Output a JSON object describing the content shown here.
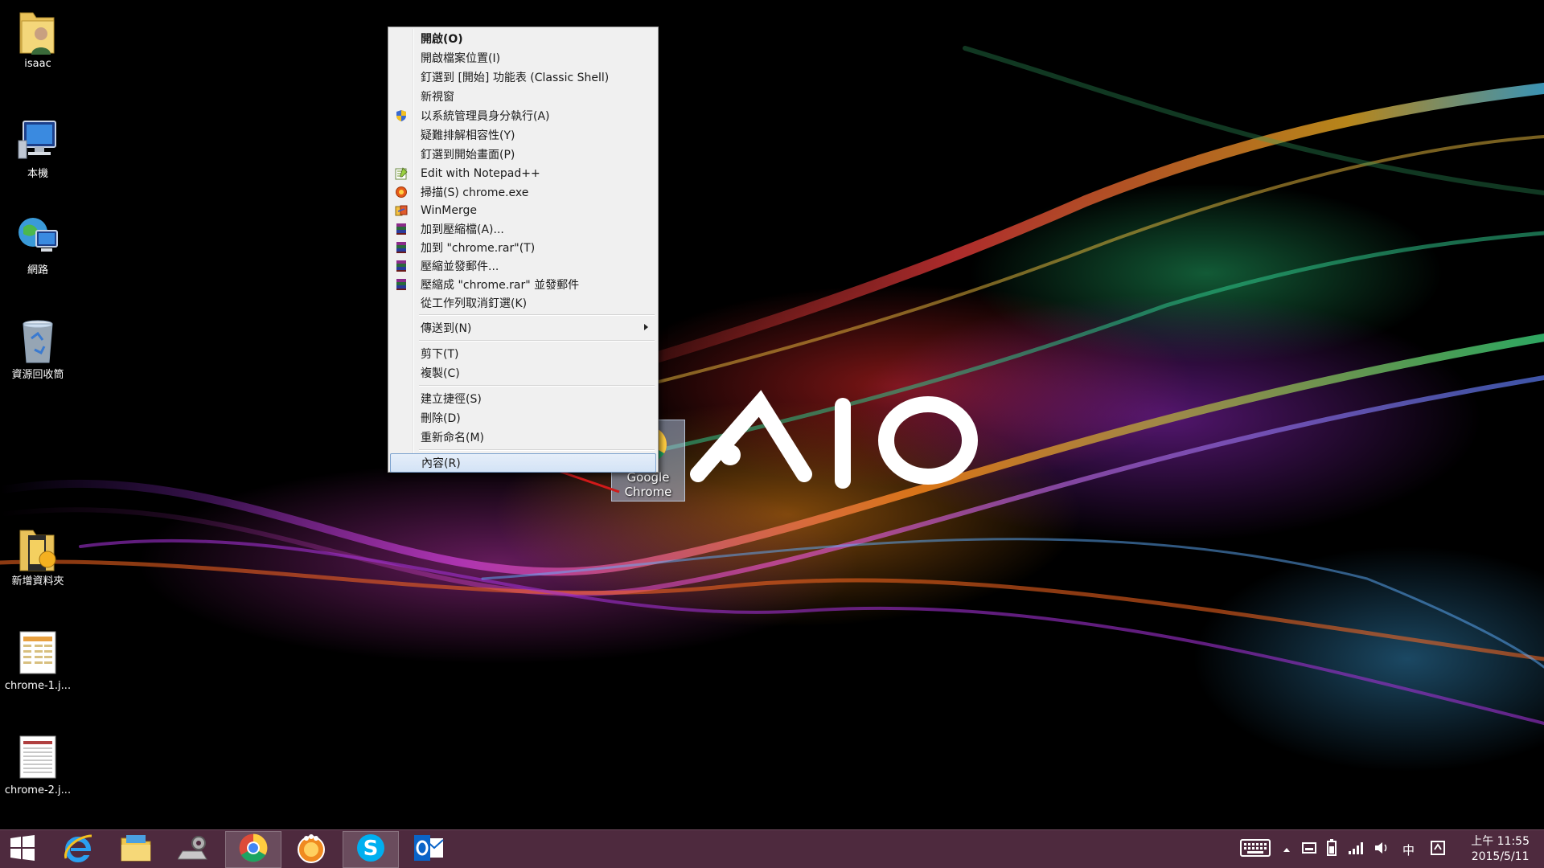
{
  "desktop": {
    "icons": [
      {
        "label": "isaac",
        "icon": "user-folder-icon"
      },
      {
        "label": "本機",
        "icon": "computer-icon"
      },
      {
        "label": "網路",
        "icon": "network-icon"
      },
      {
        "label": "資源回收筒",
        "icon": "recycle-bin-icon"
      },
      {
        "label": "新增資料夾",
        "icon": "folder-icon"
      },
      {
        "label": "chrome-1.j...",
        "icon": "image-file-icon"
      },
      {
        "label": "chrome-2.j...",
        "icon": "image-file-icon"
      }
    ],
    "dragged_shortcut": {
      "label": "Google Chrome",
      "icon": "chrome-icon"
    },
    "wallpaper_logo": "VAIO"
  },
  "context_menu": {
    "items": [
      {
        "label": "開啟(O)"
      },
      {
        "label": "開啟檔案位置(I)"
      },
      {
        "label": "釘選到 [開始] 功能表 (Classic Shell)"
      },
      {
        "label": "新視窗"
      },
      {
        "label": "以系統管理員身分執行(A)",
        "icon": "uac-shield-icon"
      },
      {
        "label": "疑難排解相容性(Y)"
      },
      {
        "label": "釘選到開始畫面(P)"
      },
      {
        "label": "Edit with Notepad++",
        "icon": "notepadpp-icon"
      },
      {
        "label": "掃描(S) chrome.exe",
        "icon": "antivirus-icon"
      },
      {
        "label": "WinMerge",
        "icon": "winmerge-icon"
      },
      {
        "label": "加到壓縮檔(A)...",
        "icon": "winrar-icon"
      },
      {
        "label": "加到 \"chrome.rar\"(T)",
        "icon": "winrar-icon"
      },
      {
        "label": "壓縮並發郵件...",
        "icon": "winrar-icon"
      },
      {
        "label": "壓縮成 \"chrome.rar\" 並發郵件",
        "icon": "winrar-icon"
      },
      {
        "label": "從工作列取消釘選(K)"
      },
      {
        "label": "傳送到(N)"
      },
      {
        "label": "剪下(T)"
      },
      {
        "label": "複製(C)"
      },
      {
        "label": "建立捷徑(S)"
      },
      {
        "label": "刪除(D)"
      },
      {
        "label": "重新命名(M)"
      },
      {
        "label": "內容(R)"
      }
    ]
  },
  "taskbar": {
    "buttons": [
      {
        "name": "start",
        "icon": "windows-logo-icon"
      },
      {
        "name": "internet-explorer",
        "icon": "internet-explorer-icon"
      },
      {
        "name": "file-explorer",
        "icon": "file-explorer-icon"
      },
      {
        "name": "settings-tool",
        "icon": "gear-laptop-icon"
      },
      {
        "name": "chrome",
        "icon": "chrome-icon"
      },
      {
        "name": "orange-app",
        "icon": "orange-app-icon"
      },
      {
        "name": "skype",
        "icon": "skype-icon"
      },
      {
        "name": "outlook",
        "icon": "outlook-icon"
      }
    ],
    "tray": {
      "ime_label": "中",
      "time": "上午 11:55",
      "date": "2015/5/11"
    }
  },
  "colors": {
    "taskbar": "#4e2a3e",
    "menu_bg": "#f0f0f0",
    "menu_highlight": "#d3e3f6",
    "annotation_arrow": "#d11a1a"
  }
}
